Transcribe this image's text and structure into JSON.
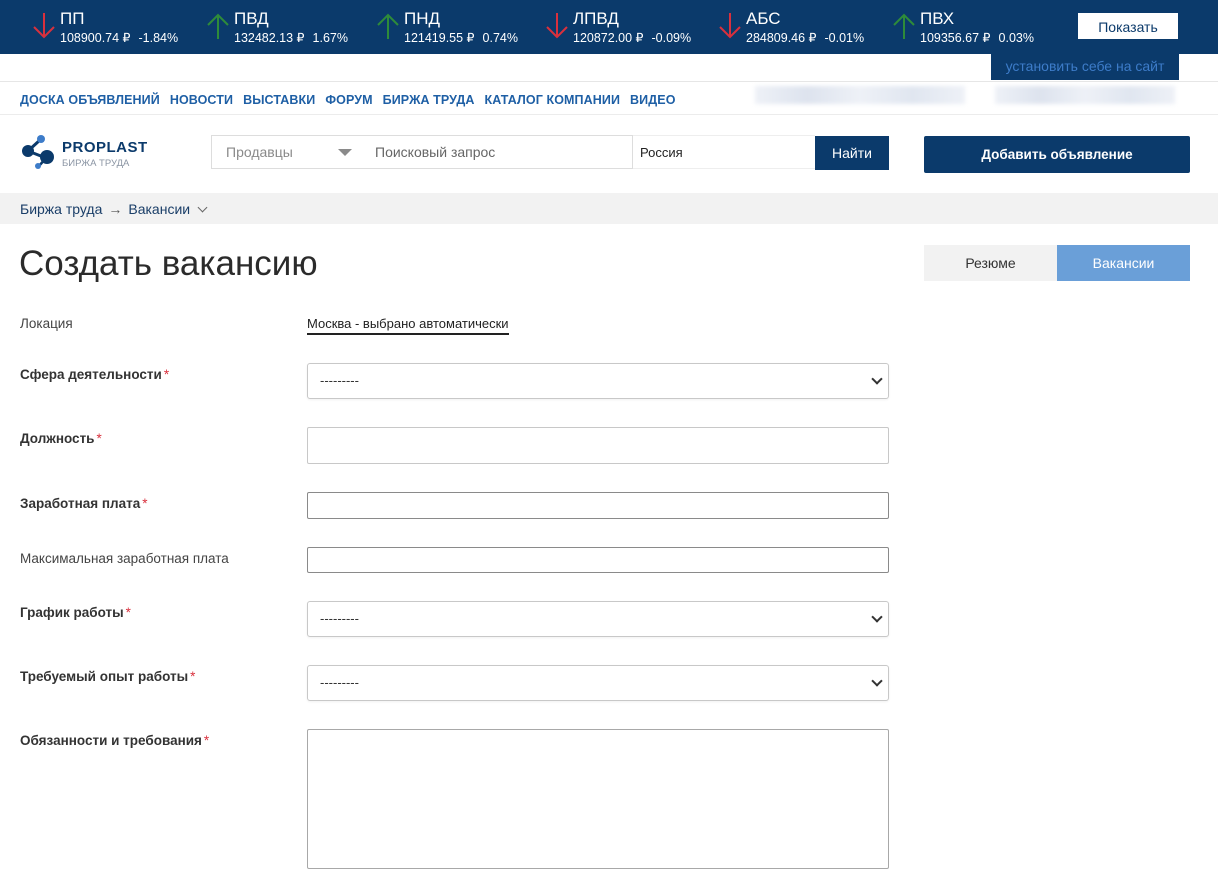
{
  "ticker": [
    {
      "name": "ПП",
      "price": "108900.74 ₽",
      "change": "-1.84%",
      "direction": "down"
    },
    {
      "name": "ПВД",
      "price": "132482.13 ₽",
      "change": "1.67%",
      "direction": "up"
    },
    {
      "name": "ПНД",
      "price": "121419.55 ₽",
      "change": "0.74%",
      "direction": "up"
    },
    {
      "name": "ЛПВД",
      "price": "120872.00 ₽",
      "change": "-0.09%",
      "direction": "down"
    },
    {
      "name": "АБС",
      "price": "284809.46 ₽",
      "change": "-0.01%",
      "direction": "down"
    },
    {
      "name": "ПВХ",
      "price": "109356.67 ₽",
      "change": "0.03%",
      "direction": "up"
    }
  ],
  "ticker_show_label": "Показать",
  "ticker_install_label": "установить себе на сайт",
  "nav": [
    "ДОСКА ОБЪЯВЛЕНИЙ",
    "НОВОСТИ",
    "ВЫСТАВКИ",
    "ФОРУМ",
    "БИРЖА ТРУДА",
    "КАТАЛОГ КОМПАНИИ",
    "ВИДЕО"
  ],
  "logo": {
    "name": "PROPLAST",
    "sub": "БИРЖА ТРУДА"
  },
  "search": {
    "category": "Продавцы",
    "placeholder": "Поисковый запрос",
    "region": "Россия",
    "button": "Найти"
  },
  "add_button": "Добавить объявление",
  "breadcrumb": {
    "root": "Биржа труда",
    "sep": "→",
    "current": "Вакансии"
  },
  "page_title": "Создать вакансию",
  "tabs": {
    "resume": "Резюме",
    "vacancies": "Вакансии"
  },
  "form": {
    "location_label": "Локация",
    "location_value": "Москва - выбрано автоматически",
    "sphere_label": "Сфера деятельности",
    "sphere_value": "---------",
    "position_label": "Должность",
    "salary_label": "Заработная плата",
    "max_salary_label": "Максимальная заработная плата",
    "schedule_label": "График работы",
    "schedule_value": "---------",
    "experience_label": "Требуемый опыт работы",
    "experience_value": "---------",
    "duties_label": "Обязанности и требования",
    "required_mark": "*"
  },
  "colors": {
    "brand": "#0b3a6b",
    "up": "#2e8b3a",
    "down": "#d9303d",
    "tab_active": "#6a9fd8"
  }
}
